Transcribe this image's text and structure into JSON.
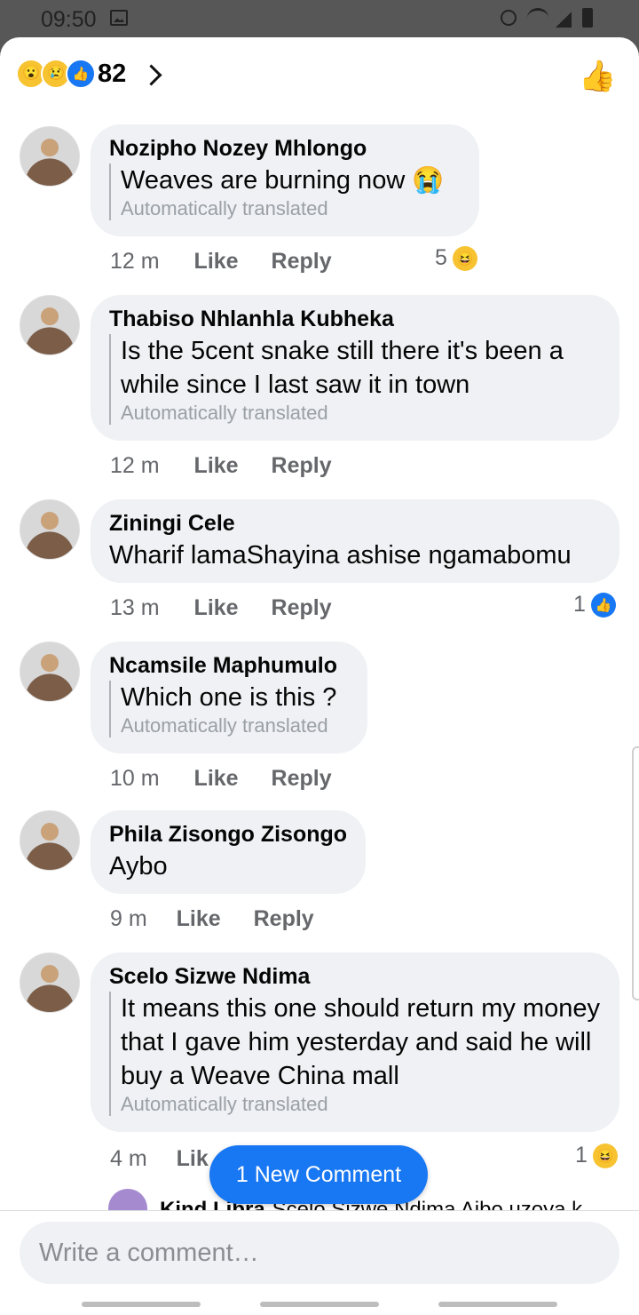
{
  "status_bar": {
    "time": "09:50"
  },
  "reactions": {
    "emojis": [
      "😮",
      "😢",
      "👍"
    ],
    "count": "82"
  },
  "comments": [
    {
      "author": "Nozipho Nozey Mhlongo",
      "text": "Weaves are burning now 😭",
      "translated": "Automatically translated",
      "time": "12 m",
      "like": "Like",
      "reply": "Reply",
      "reaction_count": "5",
      "reaction_emoji": "😆"
    },
    {
      "author": "Thabiso Nhlanhla Kubheka",
      "text": "Is the 5cent snake still there it's been a while since I last saw it in town",
      "translated": "Automatically translated",
      "time": "12 m",
      "like": "Like",
      "reply": "Reply"
    },
    {
      "author": "Ziningi Cele",
      "text": "Wharif lamaShayina ashise ngamabomu",
      "time": "13 m",
      "like": "Like",
      "reply": "Reply",
      "reaction_count": "1",
      "reaction_emoji": "👍"
    },
    {
      "author": "Ncamsile Maphumulo",
      "text": "Which one is this ?",
      "translated": "Automatically translated",
      "time": "10 m",
      "like": "Like",
      "reply": "Reply"
    },
    {
      "author": "Phila Zisongo Zisongo",
      "text": "Aybo",
      "time": "9 m",
      "like": "Like",
      "reply": "Reply"
    },
    {
      "author": "Scelo Sizwe Ndima",
      "text": "It means this one should return my money that I gave him yesterday and said he will buy a Weave China mall",
      "translated": "Automatically translated",
      "time": "4 m",
      "like": "Lik",
      "reaction_count": "1",
      "reaction_emoji": "😆"
    }
  ],
  "reply_preview": {
    "author": "Kind Libra",
    "text": "Scelo Sizwe Ndima Aibo uzoya k"
  },
  "new_comment_label": "1 New Comment",
  "compose": {
    "placeholder": "Write a comment…"
  }
}
